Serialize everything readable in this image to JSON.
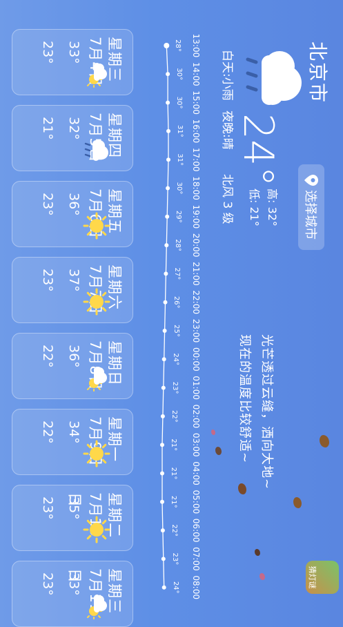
{
  "header": {
    "city": "北京市",
    "current_temp": "24°",
    "high": "高: 32°",
    "low": "低: 21°",
    "day_condition": "白天:小雨",
    "night_condition": "夜晚:晴",
    "wind": "北风 3 级",
    "select_city_label": "选择城市"
  },
  "taglines": [
    "光芒透过云缝，洒向大地~",
    "现在的温度比较舒适~"
  ],
  "hourly": {
    "times": [
      "13:00",
      "14:00",
      "15:00",
      "16:00",
      "17:00",
      "18:00",
      "19:00",
      "20:00",
      "21:00",
      "22:00",
      "23:00",
      "00:00",
      "01:00",
      "02:00",
      "03:00",
      "04:00",
      "05:00",
      "06:00",
      "07:00",
      "08:00"
    ],
    "temps": [
      "28°",
      "30°",
      "30°",
      "31°",
      "31°",
      "30°",
      "29°",
      "28°",
      "27°",
      "26°",
      "25°",
      "24°",
      "23°",
      "22°",
      "21°",
      "21°",
      "21°",
      "22°",
      "23°",
      "24°"
    ],
    "temp_values": [
      28,
      30,
      30,
      31,
      31,
      30,
      29,
      28,
      27,
      26,
      25,
      24,
      23,
      22,
      21,
      21,
      21,
      22,
      23,
      24
    ]
  },
  "forecast": [
    {
      "day": "星期三",
      "date": "7月4日",
      "high": "33°",
      "low": "23°",
      "icon": "cloud-sun-icon"
    },
    {
      "day": "星期四",
      "date": "7月5日",
      "high": "32°",
      "low": "21°",
      "icon": "cloud-rain-icon"
    },
    {
      "day": "星期五",
      "date": "7月6日",
      "high": "36°",
      "low": "23°",
      "icon": "sun-icon"
    },
    {
      "day": "星期六",
      "date": "7月7日",
      "high": "37°",
      "low": "23°",
      "icon": "sun-icon"
    },
    {
      "day": "星期日",
      "date": "7月8日",
      "high": "36°",
      "low": "22°",
      "icon": "cloud-sun-icon"
    },
    {
      "day": "星期一",
      "date": "7月9日",
      "high": "34°",
      "low": "22°",
      "icon": "sun-icon"
    },
    {
      "day": "星期二",
      "date": "7月10日",
      "high": "35°",
      "low": "23°",
      "icon": "sun-icon"
    },
    {
      "day": "星期三",
      "date": "7月11日",
      "high": "33°",
      "low": "23°",
      "icon": "cloud-sun-icon"
    }
  ],
  "app_badge": "猜灯谜"
}
